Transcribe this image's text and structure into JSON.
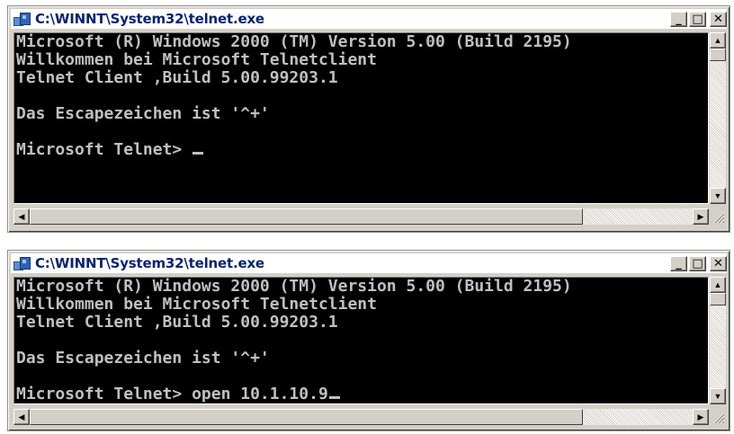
{
  "window1": {
    "title": "C:\\WINNT\\System32\\telnet.exe",
    "icon": "console-app-icon",
    "buttons": {
      "minimize": "_",
      "maximize": "□",
      "close": "✕"
    },
    "lines": [
      "Microsoft (R) Windows 2000 (TM) Version 5.00 (Build 2195)",
      "Willkommen bei Microsoft Telnetclient",
      "Telnet Client ,Build 5.00.99203.1",
      "",
      "Das Escapezeichen ist '^+'",
      "",
      "Microsoft Telnet> "
    ]
  },
  "window2": {
    "title": "C:\\WINNT\\System32\\telnet.exe",
    "icon": "console-app-icon",
    "buttons": {
      "minimize": "_",
      "maximize": "□",
      "close": "✕"
    },
    "lines": [
      "Microsoft (R) Windows 2000 (TM) Version 5.00 (Build 2195)",
      "Willkommen bei Microsoft Telnetclient",
      "Telnet Client ,Build 5.00.99203.1",
      "",
      "Das Escapezeichen ist '^+'",
      "",
      "Microsoft Telnet> open 10.1.10.9"
    ]
  },
  "scroll_arrows": {
    "up": "▲",
    "down": "▼",
    "left": "◀",
    "right": "▶"
  },
  "colors": {
    "console_background": "#000000",
    "console_text": "#c0c0c0",
    "title_text": "#0a246a",
    "window_frame": "#d4d0c8"
  }
}
